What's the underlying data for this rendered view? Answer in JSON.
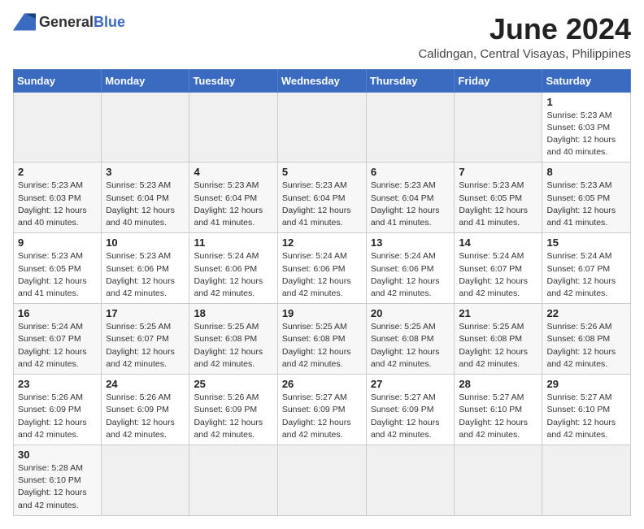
{
  "header": {
    "logo_text_general": "General",
    "logo_text_blue": "Blue",
    "month_year": "June 2024",
    "location": "Calidngan, Central Visayas, Philippines"
  },
  "weekdays": [
    "Sunday",
    "Monday",
    "Tuesday",
    "Wednesday",
    "Thursday",
    "Friday",
    "Saturday"
  ],
  "weeks": [
    [
      {
        "day": "",
        "empty": true
      },
      {
        "day": "",
        "empty": true
      },
      {
        "day": "",
        "empty": true
      },
      {
        "day": "",
        "empty": true
      },
      {
        "day": "",
        "empty": true
      },
      {
        "day": "",
        "empty": true
      },
      {
        "day": "1",
        "sunrise": "5:23 AM",
        "sunset": "6:03 PM",
        "daylight": "12 hours and 40 minutes."
      }
    ],
    [
      {
        "day": "2",
        "sunrise": "5:23 AM",
        "sunset": "6:03 PM",
        "daylight": "12 hours and 40 minutes."
      },
      {
        "day": "3",
        "sunrise": "5:23 AM",
        "sunset": "6:04 PM",
        "daylight": "12 hours and 40 minutes."
      },
      {
        "day": "4",
        "sunrise": "5:23 AM",
        "sunset": "6:04 PM",
        "daylight": "12 hours and 41 minutes."
      },
      {
        "day": "5",
        "sunrise": "5:23 AM",
        "sunset": "6:04 PM",
        "daylight": "12 hours and 41 minutes."
      },
      {
        "day": "6",
        "sunrise": "5:23 AM",
        "sunset": "6:04 PM",
        "daylight": "12 hours and 41 minutes."
      },
      {
        "day": "7",
        "sunrise": "5:23 AM",
        "sunset": "6:05 PM",
        "daylight": "12 hours and 41 minutes."
      },
      {
        "day": "8",
        "sunrise": "5:23 AM",
        "sunset": "6:05 PM",
        "daylight": "12 hours and 41 minutes."
      }
    ],
    [
      {
        "day": "9",
        "sunrise": "5:23 AM",
        "sunset": "6:05 PM",
        "daylight": "12 hours and 41 minutes."
      },
      {
        "day": "10",
        "sunrise": "5:23 AM",
        "sunset": "6:06 PM",
        "daylight": "12 hours and 42 minutes."
      },
      {
        "day": "11",
        "sunrise": "5:24 AM",
        "sunset": "6:06 PM",
        "daylight": "12 hours and 42 minutes."
      },
      {
        "day": "12",
        "sunrise": "5:24 AM",
        "sunset": "6:06 PM",
        "daylight": "12 hours and 42 minutes."
      },
      {
        "day": "13",
        "sunrise": "5:24 AM",
        "sunset": "6:06 PM",
        "daylight": "12 hours and 42 minutes."
      },
      {
        "day": "14",
        "sunrise": "5:24 AM",
        "sunset": "6:07 PM",
        "daylight": "12 hours and 42 minutes."
      },
      {
        "day": "15",
        "sunrise": "5:24 AM",
        "sunset": "6:07 PM",
        "daylight": "12 hours and 42 minutes."
      }
    ],
    [
      {
        "day": "16",
        "sunrise": "5:24 AM",
        "sunset": "6:07 PM",
        "daylight": "12 hours and 42 minutes."
      },
      {
        "day": "17",
        "sunrise": "5:25 AM",
        "sunset": "6:07 PM",
        "daylight": "12 hours and 42 minutes."
      },
      {
        "day": "18",
        "sunrise": "5:25 AM",
        "sunset": "6:08 PM",
        "daylight": "12 hours and 42 minutes."
      },
      {
        "day": "19",
        "sunrise": "5:25 AM",
        "sunset": "6:08 PM",
        "daylight": "12 hours and 42 minutes."
      },
      {
        "day": "20",
        "sunrise": "5:25 AM",
        "sunset": "6:08 PM",
        "daylight": "12 hours and 42 minutes."
      },
      {
        "day": "21",
        "sunrise": "5:25 AM",
        "sunset": "6:08 PM",
        "daylight": "12 hours and 42 minutes."
      },
      {
        "day": "22",
        "sunrise": "5:26 AM",
        "sunset": "6:08 PM",
        "daylight": "12 hours and 42 minutes."
      }
    ],
    [
      {
        "day": "23",
        "sunrise": "5:26 AM",
        "sunset": "6:09 PM",
        "daylight": "12 hours and 42 minutes."
      },
      {
        "day": "24",
        "sunrise": "5:26 AM",
        "sunset": "6:09 PM",
        "daylight": "12 hours and 42 minutes."
      },
      {
        "day": "25",
        "sunrise": "5:26 AM",
        "sunset": "6:09 PM",
        "daylight": "12 hours and 42 minutes."
      },
      {
        "day": "26",
        "sunrise": "5:27 AM",
        "sunset": "6:09 PM",
        "daylight": "12 hours and 42 minutes."
      },
      {
        "day": "27",
        "sunrise": "5:27 AM",
        "sunset": "6:09 PM",
        "daylight": "12 hours and 42 minutes."
      },
      {
        "day": "28",
        "sunrise": "5:27 AM",
        "sunset": "6:10 PM",
        "daylight": "12 hours and 42 minutes."
      },
      {
        "day": "29",
        "sunrise": "5:27 AM",
        "sunset": "6:10 PM",
        "daylight": "12 hours and 42 minutes."
      }
    ],
    [
      {
        "day": "30",
        "sunrise": "5:28 AM",
        "sunset": "6:10 PM",
        "daylight": "12 hours and 42 minutes."
      },
      {
        "day": "",
        "empty": true
      },
      {
        "day": "",
        "empty": true
      },
      {
        "day": "",
        "empty": true
      },
      {
        "day": "",
        "empty": true
      },
      {
        "day": "",
        "empty": true
      },
      {
        "day": "",
        "empty": true
      }
    ]
  ],
  "labels": {
    "sunrise": "Sunrise:",
    "sunset": "Sunset:",
    "daylight": "Daylight:"
  }
}
